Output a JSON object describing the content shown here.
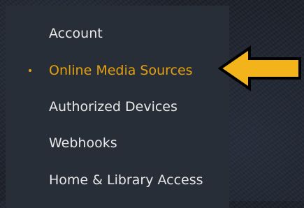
{
  "menu": {
    "items": [
      {
        "label": "Account",
        "active": false
      },
      {
        "label": "Online Media Sources",
        "active": true
      },
      {
        "label": "Authorized Devices",
        "active": false
      },
      {
        "label": "Webhooks",
        "active": false
      },
      {
        "label": "Home & Library Access",
        "active": false
      }
    ]
  },
  "annotation": {
    "arrow_icon": "arrow-left-icon",
    "arrow_color": "#f3b31b",
    "arrow_outline": "#000000"
  },
  "colors": {
    "accent": "#e5a00d",
    "panel": "#282e38",
    "text": "#e8e8e8"
  }
}
